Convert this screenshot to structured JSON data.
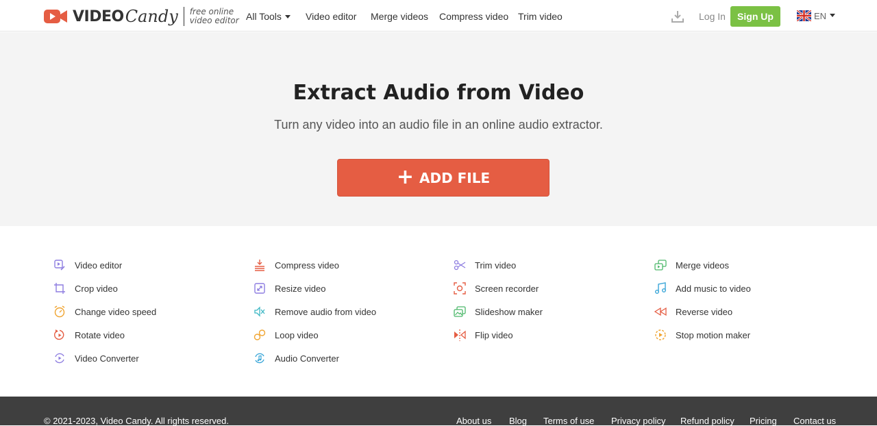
{
  "brand": {
    "name_bold": "VIDEO",
    "name_script": "Candy",
    "tagline_1": "free online",
    "tagline_2": "video editor",
    "accent_color": "#e55d43"
  },
  "nav": {
    "items": [
      "All Tools",
      "Video editor",
      "Merge videos",
      "Compress video",
      "Trim video"
    ]
  },
  "header": {
    "login": "Log In",
    "signup": "Sign Up",
    "language": "EN",
    "signup_color": "#7bc144"
  },
  "hero": {
    "title": "Extract Audio from Video",
    "subtitle": "Turn any video into an audio file in an online audio extractor.",
    "add_button": "ADD FILE"
  },
  "tools": {
    "columns": [
      [
        {
          "label": "Video editor",
          "icon": "video-edit-icon",
          "color": "#8d7de0"
        },
        {
          "label": "Crop video",
          "icon": "crop-icon",
          "color": "#8d7de0"
        },
        {
          "label": "Change video speed",
          "icon": "speed-clock-icon",
          "color": "#f0a430"
        },
        {
          "label": "Rotate video",
          "icon": "rotate-icon",
          "color": "#e55d43"
        },
        {
          "label": "Video Converter",
          "icon": "convert-icon",
          "color": "#8d7de0"
        }
      ],
      [
        {
          "label": "Compress video",
          "icon": "compress-icon",
          "color": "#e55d43"
        },
        {
          "label": "Resize video",
          "icon": "resize-icon",
          "color": "#8d7de0"
        },
        {
          "label": "Remove audio from video",
          "icon": "mute-icon",
          "color": "#3cb7c4"
        },
        {
          "label": "Loop video",
          "icon": "loop-icon",
          "color": "#f0a430"
        },
        {
          "label": "Audio Converter",
          "icon": "audio-convert-icon",
          "color": "#3aa6d8"
        }
      ],
      [
        {
          "label": "Trim video",
          "icon": "scissors-icon",
          "color": "#8d7de0"
        },
        {
          "label": "Screen recorder",
          "icon": "screen-record-icon",
          "color": "#e55d43"
        },
        {
          "label": "Slideshow maker",
          "icon": "slideshow-icon",
          "color": "#4cb86a"
        },
        {
          "label": "Flip video",
          "icon": "flip-icon",
          "color": "#e55d43"
        }
      ],
      [
        {
          "label": "Merge videos",
          "icon": "merge-icon",
          "color": "#4cb86a"
        },
        {
          "label": "Add music to video",
          "icon": "music-note-icon",
          "color": "#3aa6d8"
        },
        {
          "label": "Reverse video",
          "icon": "rewind-icon",
          "color": "#e55d43"
        },
        {
          "label": "Stop motion maker",
          "icon": "stop-motion-icon",
          "color": "#f0a430"
        }
      ]
    ]
  },
  "footer": {
    "copyright": "© 2021-2023, Video Candy. All rights reserved.",
    "links": [
      "About us",
      "Blog",
      "Terms of use",
      "Privacy policy",
      "Refund policy",
      "Pricing",
      "Contact us"
    ]
  }
}
